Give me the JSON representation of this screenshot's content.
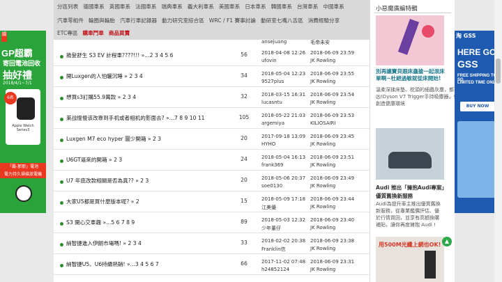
{
  "nav": {
    "line1": [
      "分區列表",
      "德國車系",
      "英國車系",
      "法國車系",
      "瑞典車系",
      "義大利車系",
      "美國車系",
      "日本車系",
      "韓國車系",
      "台灣車系",
      "中國車系"
    ],
    "line2": [
      "汽車零組件",
      "輪圈與輪胎",
      "汽車行車記錄器",
      "動力研究室綜合區",
      "WRC / F1 賽事討論",
      "動研室七嘴八舌區",
      "消費經驗分享"
    ],
    "line3": [
      {
        "label": "ETC專區",
        "highlight": false
      },
      {
        "label": "購車鬥車",
        "highlight": true
      },
      {
        "label": "商品買賣",
        "highlight": true
      }
    ]
  },
  "top_partial": {
    "user2": "毛帝未安",
    "user1": "ansejuang"
  },
  "threads": [
    {
      "title": "捲髮舒生 S3 EV 計程車????!!! »...2 3 4 5 6",
      "count": "56",
      "date1": "2018-04-08 12:26",
      "user1": "ufovin",
      "date2": "2018-06-09 23:59",
      "user2": "JK Rowling"
    },
    {
      "title": "開Luxgen的人怕曬沉睡 » 2 3 4",
      "count": "34",
      "date1": "2018-05-04 12:23",
      "user1": "9527plus",
      "date2": "2018-06-09 23:55",
      "user2": "JK Rowling"
    },
    {
      "title": "想買s3訂購55.9萬款 » 2 3 4",
      "count": "32",
      "date1": "2018-03-15 16:31",
      "user1": "lucasntu",
      "date2": "2018-06-09 23:54",
      "user2": "JK Rowling"
    },
    {
      "title": "莱战慢慢该改靠到手机或者相机的影面去? »...7 8 9 10 11",
      "count": "105",
      "date1": "2018-05-22 21:03",
      "user1": "argemiya",
      "date2": "2018-06-09 23:53",
      "user2": "KILIOSAIRI"
    },
    {
      "title": "Luxgen M7 eco hyper 圖少開箱 » 2 3",
      "count": "20",
      "date1": "2017-09-18 13:09",
      "user1": "HYHO",
      "date2": "2018-06-09 23:45",
      "user2": "JK Rowling"
    },
    {
      "title": "U6GT逼來的開箱 » 2 3",
      "count": "24",
      "date1": "2018-05-04 16:13",
      "user1": "frank369",
      "date2": "2018-06-09 23:51",
      "user2": "JK Rowling"
    },
    {
      "title": "U7 年底改款相關是否為真?? » 2 3",
      "count": "20",
      "date1": "2018-05-06 20:37",
      "user1": "soe0130",
      "date2": "2018-06-09 23:49",
      "user2": "JK Rowling"
    },
    {
      "title": "大家U5都是買什麼版本呢? » 2",
      "count": "15",
      "date1": "2018-05-09 17:18",
      "user1": "江美優",
      "date2": "2018-06-09 23:44",
      "user2": "JK Rowling"
    },
    {
      "title": "S3 開心交車趣 »...5 6 7 8 9",
      "count": "89",
      "date1": "2018-05-03 12:32",
      "user1": "少年董仔",
      "date2": "2018-06-09 23:40",
      "user2": "JK Rowling"
    },
    {
      "title": "納智捷進入伊朗市場嗎! » 2 3 4",
      "count": "33",
      "date1": "2018-02-02 20:38",
      "user1": "Franklin信",
      "date2": "2018-06-09 23:38",
      "user2": "JK Rowling"
    },
    {
      "title": "納智捷U5、U6持續熱銷! »...3 4 5 6 7",
      "count": "66",
      "date1": "2017-11-02 07:48",
      "user1": "h24852124",
      "date2": "2018-06-09 23:31",
      "user2": "JK Rowling"
    },
    {
      "title": "",
      "count": "",
      "date1": "",
      "user1": "",
      "date2": "",
      "user2": ""
    }
  ],
  "side": {
    "heading": "小惡魔廣編特輯",
    "item1_title": "別再讓寶貝跟床蟲搶一起滾床單啊~杜絕過敏就從床開始!",
    "item1_desc": [
      "溫柔深揉床墊、枕頭的細蟲灰塵，都可能是小寶貝過敏的元",
      "凶!Dyson V7 Trigger手持吸塵器，很方便又不笨拙，幫寶貝",
      "創造健康環境"
    ],
    "item2_title": "Audi 推出「擁抱Audi專案」",
    "item2_subtitle": "優質舊換新服務",
    "item2_desc": [
      "Audi為提升車主推出優質舊換",
      "新服務，從專業鑑價評估、優",
      "於行情買回，並享有高額換購",
      "補貼，讓你再度擁抱 Audi !"
    ],
    "item3_title": "用500M光纖上網也OK!"
  },
  "ads": {
    "left": {
      "brand": "燦",
      "line1": "GP超霸",
      "line2": "寄回電池回收",
      "line3": "抽好禮",
      "date": "2018/4/1~7/1",
      "prize": "Apple Watch Series3",
      "badge": "6名",
      "strip1": "「霸-那那」電池",
      "strip2": "電力持久掃描放電機"
    },
    "right": {
      "logo": "淘 GSS",
      "line1": "HERE GO",
      "line2": "GSS",
      "line3": "FREE SHIPPING TO SG",
      "line4": "LIMITED TIME ONLY",
      "cta": "BUY NOW"
    }
  },
  "up_symbol": "▲"
}
